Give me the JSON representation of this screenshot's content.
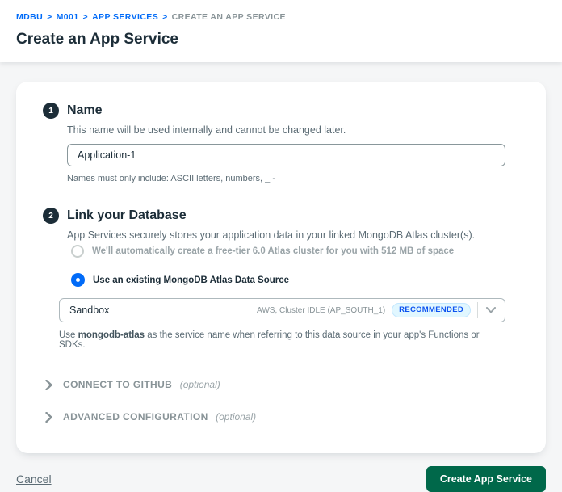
{
  "breadcrumb": {
    "separator": ">",
    "links": [
      "MDBU",
      "M001",
      "APP SERVICES"
    ],
    "current": "CREATE AN APP SERVICE"
  },
  "page": {
    "title": "Create an App Service"
  },
  "form": {
    "name_section": {
      "number": "1",
      "title": "Name",
      "description": "This name will be used internally and cannot be changed later.",
      "input_value": "Application-1",
      "helper": "Names must only include: ASCII letters, numbers, _ -"
    },
    "database_section": {
      "number": "2",
      "title": "Link your Database",
      "description": "App Services securely stores your application data in your linked MongoDB Atlas cluster(s).",
      "options": [
        {
          "label": "We'll automatically create a free-tier 6.0 Atlas cluster for you with 512 MB of space",
          "selected": false
        },
        {
          "label": "Use an existing MongoDB Atlas Data Source",
          "selected": true
        }
      ],
      "select": {
        "value": "Sandbox",
        "meta": "AWS, Cluster IDLE (AP_SOUTH_1)",
        "badge": "RECOMMENDED"
      },
      "helper_prefix": "Use ",
      "helper_bold": "mongodb-atlas",
      "helper_suffix": " as the service name when referring to this data source in your app's Functions or SDKs."
    },
    "collapsibles": [
      {
        "label": "CONNECT TO GITHUB",
        "suffix": "(optional)"
      },
      {
        "label": "ADVANCED CONFIGURATION",
        "suffix": "(optional)"
      }
    ]
  },
  "footer": {
    "cancel_label": "Cancel",
    "submit_label": "Create App Service"
  },
  "colors": {
    "accent_blue": "#016BF8",
    "button_green": "#00684A",
    "badge_bg": "#E1F7FF",
    "dark_navy": "#1C2D38",
    "page_bg": "#F5F6F7"
  }
}
